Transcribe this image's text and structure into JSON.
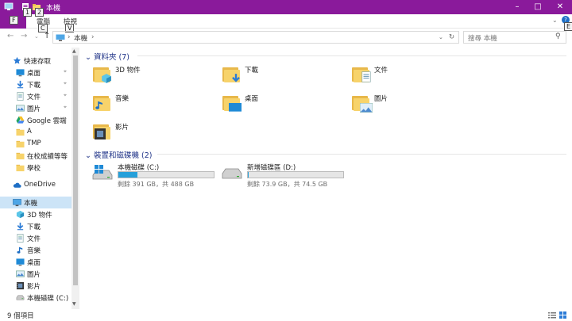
{
  "window": {
    "title": "本機"
  },
  "keytips": {
    "file": "F",
    "quick1": "1",
    "quick2": "2",
    "computer": "C",
    "view": "V",
    "help": "E"
  },
  "ribbon": {
    "tabs": [
      {
        "label": "電腦"
      },
      {
        "label": "檢視"
      }
    ]
  },
  "address": {
    "crumb": "本機"
  },
  "search": {
    "placeholder": "搜尋 本機"
  },
  "nav": {
    "items": [
      {
        "label": "快速存取",
        "icon": "star-icon",
        "pinned": false
      },
      {
        "label": "桌面",
        "icon": "desktop-icon",
        "pinned": true
      },
      {
        "label": "下載",
        "icon": "download-icon",
        "pinned": true
      },
      {
        "label": "文件",
        "icon": "document-icon",
        "pinned": true
      },
      {
        "label": "圖片",
        "icon": "picture-icon",
        "pinned": true
      },
      {
        "label": "Google 雲端",
        "icon": "google-drive-icon",
        "pinned": true
      },
      {
        "label": "A",
        "icon": "folder-icon",
        "pinned": false
      },
      {
        "label": "TMP",
        "icon": "folder-icon",
        "pinned": false
      },
      {
        "label": "在校成績等等",
        "icon": "folder-icon",
        "pinned": false
      },
      {
        "label": "學校",
        "icon": "folder-icon",
        "pinned": false
      },
      {
        "label": "OneDrive",
        "icon": "cloud-icon",
        "pinned": false
      },
      {
        "label": "本機",
        "icon": "computer-icon",
        "pinned": false
      },
      {
        "label": "3D 物件",
        "icon": "3d-objects-icon",
        "pinned": false
      },
      {
        "label": "下載",
        "icon": "download-icon",
        "pinned": false
      },
      {
        "label": "文件",
        "icon": "document-icon",
        "pinned": false
      },
      {
        "label": "音樂",
        "icon": "music-icon",
        "pinned": false
      },
      {
        "label": "桌面",
        "icon": "desktop-icon",
        "pinned": false
      },
      {
        "label": "圖片",
        "icon": "picture-icon",
        "pinned": false
      },
      {
        "label": "影片",
        "icon": "video-icon",
        "pinned": false
      },
      {
        "label": "本機磁碟 (C:)",
        "icon": "drive-icon",
        "pinned": false
      }
    ]
  },
  "folders_group": {
    "header": "資料夾 (7)",
    "items": [
      {
        "label": "3D 物件",
        "icon": "3d-objects-icon"
      },
      {
        "label": "下載",
        "icon": "download-icon"
      },
      {
        "label": "文件",
        "icon": "document-icon"
      },
      {
        "label": "音樂",
        "icon": "music-icon"
      },
      {
        "label": "桌面",
        "icon": "desktop-icon"
      },
      {
        "label": "圖片",
        "icon": "picture-icon"
      },
      {
        "label": "影片",
        "icon": "video-icon"
      }
    ]
  },
  "drives_group": {
    "header": "裝置和磁碟機 (2)",
    "items": [
      {
        "name": "本機磁碟 (C:)",
        "free_text": "剩餘 391 GB，共 488 GB",
        "used_fraction": 0.2,
        "icon": "windows-drive-icon"
      },
      {
        "name": "新增磁碟區 (D:)",
        "free_text": "剩餘 73.9 GB，共 74.5 GB",
        "used_fraction": 0.01,
        "icon": "drive-icon"
      }
    ]
  },
  "status": {
    "count": "9 個項目"
  },
  "colors": {
    "titlebar": "#8a1a9b",
    "selection": "#cce4f7",
    "accent": "#26a0da",
    "group_header": "#1e3287"
  }
}
